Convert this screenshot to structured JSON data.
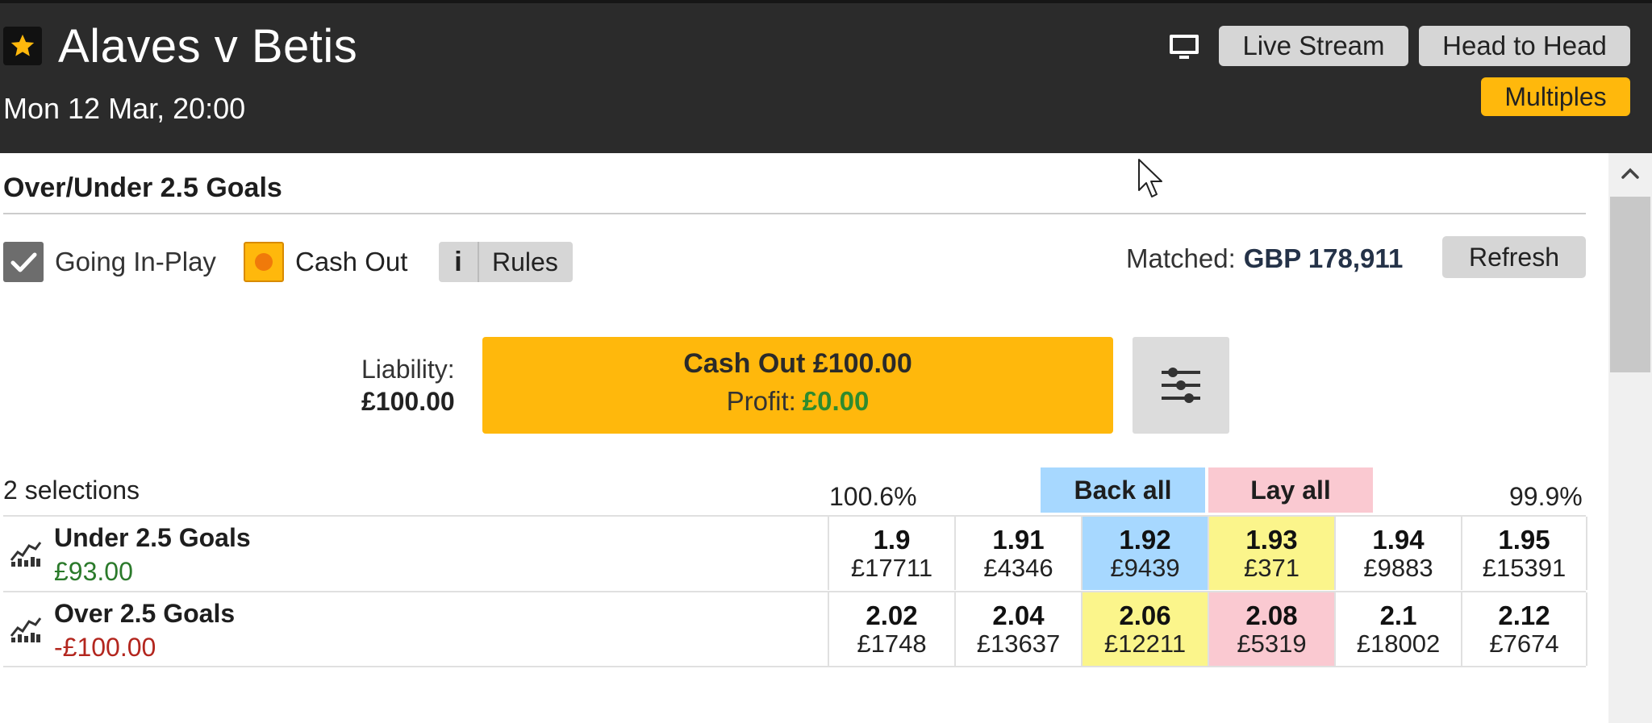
{
  "header": {
    "title": "Alaves v Betis",
    "datetime": "Mon 12 Mar, 20:00",
    "buttons": {
      "live_stream": "Live Stream",
      "head_to_head": "Head to Head",
      "multiples": "Multiples"
    },
    "icons": {
      "favourite": "star-icon",
      "tv": "tv-icon"
    },
    "colors": {
      "bar": "#2b2b2b",
      "accent": "#ffb80c"
    }
  },
  "market": {
    "title": "Over/Under 2.5 Goals",
    "going_in_play_label": "Going In-Play",
    "cash_out_label": "Cash Out",
    "rules_icon": "i",
    "rules_label": "Rules",
    "matched_label": "Matched:",
    "matched_value": "GBP 178,911",
    "refresh_label": "Refresh"
  },
  "cashout": {
    "liability_label": "Liability:",
    "liability_value": "£100.00",
    "button_title": "Cash Out £100.00",
    "profit_label": "Profit:",
    "profit_value": "£0.00"
  },
  "selections": {
    "count_label": "2 selections",
    "back_pct": "100.6%",
    "lay_pct": "99.9%",
    "back_all_label": "Back all",
    "lay_all_label": "Lay all",
    "runners": [
      {
        "name": "Under 2.5 Goals",
        "pnl": "£93.00",
        "prices": [
          {
            "price": "1.9",
            "size": "£17711"
          },
          {
            "price": "1.91",
            "size": "£4346"
          },
          {
            "price": "1.92",
            "size": "£9439"
          },
          {
            "price": "1.93",
            "size": "£371"
          },
          {
            "price": "1.94",
            "size": "£9883"
          },
          {
            "price": "1.95",
            "size": "£15391"
          }
        ]
      },
      {
        "name": "Over 2.5 Goals",
        "pnl": "-£100.00",
        "prices": [
          {
            "price": "2.02",
            "size": "£1748"
          },
          {
            "price": "2.04",
            "size": "£13637"
          },
          {
            "price": "2.06",
            "size": "£12211"
          },
          {
            "price": "2.08",
            "size": "£5319"
          },
          {
            "price": "2.1",
            "size": "£18002"
          },
          {
            "price": "2.12",
            "size": "£7674"
          }
        ]
      }
    ]
  }
}
